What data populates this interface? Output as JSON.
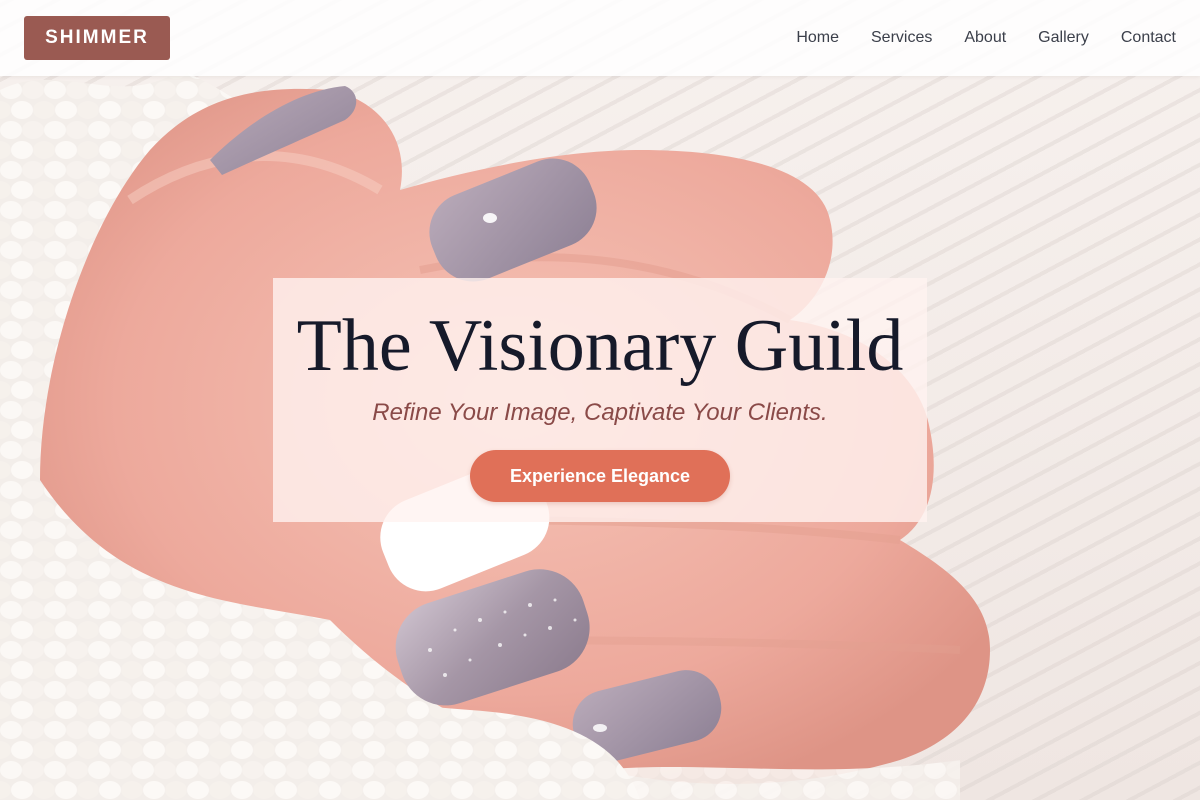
{
  "header": {
    "logo_text": "SHIMMER",
    "nav": [
      {
        "label": "Home"
      },
      {
        "label": "Services"
      },
      {
        "label": "About"
      },
      {
        "label": "Gallery"
      },
      {
        "label": "Contact"
      }
    ]
  },
  "hero": {
    "title": "The Visionary Guild",
    "subtitle": "Refine Your Image, Captivate Your Clients.",
    "cta_label": "Experience Elegance",
    "background_image": "manicured-hand-on-knit-sweater"
  },
  "colors": {
    "logo_bg": "#9a5a52",
    "cta_bg": "#e07058",
    "title_text": "#161a2a",
    "subtitle_text": "#8a4a48",
    "nav_text": "#3b3f4a",
    "nail_mauve": "#a597a9",
    "skin": "#f0b1a4"
  }
}
